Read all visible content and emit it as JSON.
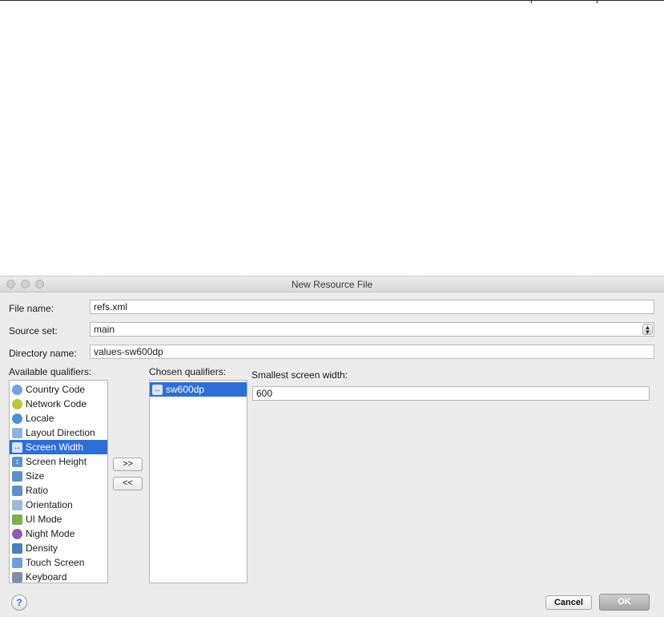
{
  "window": {
    "title": "New Resource File"
  },
  "form": {
    "file_name_label": "File name:",
    "file_name_value": "refs.xml",
    "source_set_label": "Source set:",
    "source_set_value": "main",
    "directory_name_label": "Directory name:",
    "directory_name_value": "values-sw600dp"
  },
  "available": {
    "label": "Available qualifiers:",
    "items": [
      {
        "label": "Country Code",
        "icon": "country-code-icon"
      },
      {
        "label": "Network Code",
        "icon": "network-code-icon"
      },
      {
        "label": "Locale",
        "icon": "locale-icon"
      },
      {
        "label": "Layout Direction",
        "icon": "layout-direction-icon"
      },
      {
        "label": "Screen Width",
        "icon": "screen-width-icon",
        "selected": true
      },
      {
        "label": "Screen Height",
        "icon": "screen-height-icon"
      },
      {
        "label": "Size",
        "icon": "size-icon"
      },
      {
        "label": "Ratio",
        "icon": "ratio-icon"
      },
      {
        "label": "Orientation",
        "icon": "orientation-icon"
      },
      {
        "label": "UI Mode",
        "icon": "ui-mode-icon"
      },
      {
        "label": "Night Mode",
        "icon": "night-mode-icon"
      },
      {
        "label": "Density",
        "icon": "density-icon"
      },
      {
        "label": "Touch Screen",
        "icon": "touch-screen-icon"
      },
      {
        "label": "Keyboard",
        "icon": "keyboard-icon"
      }
    ]
  },
  "transfer": {
    "add_label": ">>",
    "remove_label": "<<"
  },
  "chosen": {
    "label": "Chosen qualifiers:",
    "items": [
      {
        "label": "sw600dp",
        "icon": "screen-width-icon",
        "selected": true
      }
    ]
  },
  "detail": {
    "label": "Smallest screen width:",
    "value": "600"
  },
  "footer": {
    "help_label": "?",
    "cancel_label": "Cancel",
    "ok_label": "OK"
  },
  "colors": {
    "selection": "#2f6ed9",
    "window_bg": "#ececec"
  }
}
